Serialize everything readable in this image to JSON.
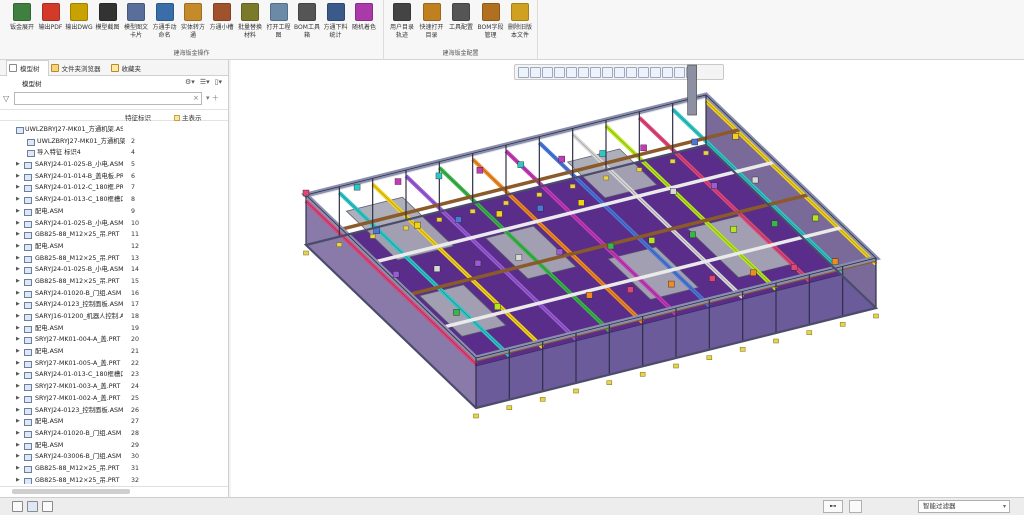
{
  "ribbon": {
    "group1": {
      "title": "建海钣金操作",
      "buttons": [
        {
          "label": "钣金展开",
          "icon": "unfold-sheetmetal-icon",
          "color": "#3f7f3f"
        },
        {
          "label": "输出PDF",
          "icon": "pdf-export-icon",
          "color": "#d33a2a"
        },
        {
          "label": "输出DWG",
          "icon": "dwg-export-icon",
          "color": "#c7a200"
        },
        {
          "label": "模型截图",
          "icon": "camera-icon",
          "color": "#333333"
        },
        {
          "label": "模型图文卡片",
          "icon": "model-card-icon",
          "color": "#5a6e9a"
        },
        {
          "label": "方通手动命名",
          "icon": "tube-naming-icon",
          "color": "#3a6ea8"
        },
        {
          "label": "实体转方通",
          "icon": "solid-to-tube-icon",
          "color": "#c58a2a"
        },
        {
          "label": "方通小槽",
          "icon": "tube-slot-icon",
          "color": "#a0522d"
        },
        {
          "label": "批量替换材料",
          "icon": "batch-material-icon",
          "color": "#7a7a2a"
        },
        {
          "label": "打开工程图",
          "icon": "open-drawing-icon",
          "color": "#6a8aa8"
        },
        {
          "label": "BOM工具箱",
          "icon": "bom-toolbox-icon",
          "color": "#555555"
        },
        {
          "label": "方通下料统计",
          "icon": "tube-cutting-stats-icon",
          "color": "#3a5a8a"
        },
        {
          "label": "随机着色",
          "icon": "random-color-icon",
          "color": "#aa3aaa"
        }
      ]
    },
    "group2": {
      "title": "建海钣金配置",
      "buttons": [
        {
          "label": "用户目录轨迹",
          "icon": "user-dir-icon",
          "color": "#444444"
        },
        {
          "label": "快速打开目录",
          "icon": "quick-open-folder-icon",
          "color": "#c08020"
        },
        {
          "label": "工具配置",
          "icon": "gear-icon",
          "color": "#555555"
        },
        {
          "label": "BOM字段管理",
          "icon": "bom-fields-icon",
          "color": "#b07020"
        },
        {
          "label": "删除旧版本文件",
          "icon": "broom-icon",
          "color": "#d0a020"
        }
      ]
    }
  },
  "left_panel": {
    "tabs": [
      {
        "label": "模型树",
        "active": true
      },
      {
        "label": "文件夹浏览器",
        "active": false
      },
      {
        "label": "收藏夹",
        "active": false
      }
    ],
    "tree_title": "模型树",
    "filter_placeholder": "",
    "col_feature_id": "特征标识",
    "col_main_display": "主表示",
    "rows": [
      {
        "name": "UWLZBRYJ27-MK01_方通机架.ASM",
        "num": "",
        "kind": "top"
      },
      {
        "name": "UWLZBRYJ27-MK01_方通机架",
        "num": "2",
        "kind": "sub"
      },
      {
        "name": "导入特征 标识4",
        "num": "4",
        "kind": "sub"
      },
      {
        "name": "SARYJ24-01-025-B_小电.ASM",
        "num": "5",
        "kind": "item"
      },
      {
        "name": "SARYJ24-01-014-B_盖电板.PRT",
        "num": "6",
        "kind": "item"
      },
      {
        "name": "SARYJ24-01-012-C_180框.PRT",
        "num": "7",
        "kind": "item"
      },
      {
        "name": "SARYJ24-01-013-C_180框槽口.PRT",
        "num": "8",
        "kind": "item"
      },
      {
        "name": "配电.ASM",
        "num": "9",
        "kind": "item"
      },
      {
        "name": "SARYJ24-01-025-B_小电.ASM",
        "num": "10",
        "kind": "item"
      },
      {
        "name": "GB825-88_M12×25_吊.PRT",
        "num": "11",
        "kind": "item"
      },
      {
        "name": "配电.ASM",
        "num": "12",
        "kind": "item"
      },
      {
        "name": "GB825-88_M12×25_吊.PRT",
        "num": "13",
        "kind": "item"
      },
      {
        "name": "SARYJ24-01-025-B_小电.ASM",
        "num": "14",
        "kind": "item"
      },
      {
        "name": "GB825-88_M12×25_吊.PRT",
        "num": "15",
        "kind": "item"
      },
      {
        "name": "SARYJ24-01020-B_门组.ASM",
        "num": "16",
        "kind": "item"
      },
      {
        "name": "SARYJ24-0123_控制面板.ASM",
        "num": "17",
        "kind": "item"
      },
      {
        "name": "SARYJ16-01200_机器人控制.ASM",
        "num": "18",
        "kind": "item"
      },
      {
        "name": "配电.ASM",
        "num": "19",
        "kind": "item"
      },
      {
        "name": "SRYJ27-MK01-004-A_盖.PRT",
        "num": "20",
        "kind": "item"
      },
      {
        "name": "配电.ASM",
        "num": "21",
        "kind": "item"
      },
      {
        "name": "SRYJ27-MK01-005-A_盖.PRT",
        "num": "22",
        "kind": "item"
      },
      {
        "name": "SARYJ24-01-013-C_180框槽口.PRT",
        "num": "23",
        "kind": "item"
      },
      {
        "name": "SRYJ27-MK01-003-A_盖.PRT",
        "num": "24",
        "kind": "item"
      },
      {
        "name": "SRYJ27-MK01-002-A_盖.PRT",
        "num": "25",
        "kind": "item"
      },
      {
        "name": "SARYJ24-0123_控制面板.ASM",
        "num": "26",
        "kind": "item"
      },
      {
        "name": "配电.ASM",
        "num": "27",
        "kind": "item"
      },
      {
        "name": "SARYJ24-01020-B_门组.ASM",
        "num": "28",
        "kind": "item"
      },
      {
        "name": "配电.ASM",
        "num": "29",
        "kind": "item"
      },
      {
        "name": "SARYJ24-03006-B_门组.ASM",
        "num": "30",
        "kind": "item"
      },
      {
        "name": "GB825-88_M12×25_吊.PRT",
        "num": "31",
        "kind": "item"
      },
      {
        "name": "GB825-88_M12×25_吊.PRT",
        "num": "32",
        "kind": "item"
      }
    ]
  },
  "status_bar": {
    "selection_filter": "智能过滤器",
    "find_icon": "binoculars-icon"
  },
  "colors": {
    "frame_dark": "#5a3a8a",
    "frame_rail": "#8a8fb0",
    "panel_gray": "#a7a9b5",
    "floor_purple": "#5b2d8a"
  }
}
